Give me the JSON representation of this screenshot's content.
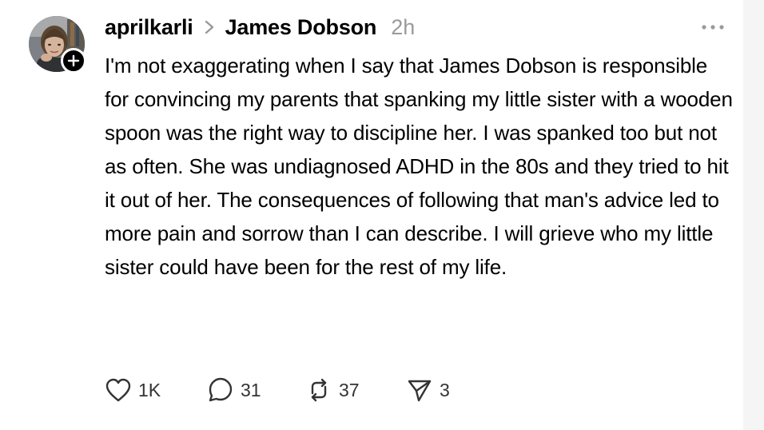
{
  "post": {
    "username": "aprilkarli",
    "reply_to": "James Dobson",
    "timestamp": "2h",
    "text": "I'm not exaggerating when I say that James Dobson is responsible for convincing my parents that spanking my little sister with a wooden spoon was the right way to discipline her. I was spanked too but not as often. She was undiagnosed ADHD in the 80s and they tried to hit it out of her. The consequences of following that man's advice led to more pain and sorrow than I can describe. I will grieve who my little sister could have been for the rest of my life."
  },
  "actions": {
    "likes": "1K",
    "comments": "31",
    "reposts": "37",
    "shares": "3"
  },
  "icons": {
    "avatar": "profile-photo",
    "follow": "plus-icon",
    "separator": "chevron-right-icon",
    "more": "more-horizontal-icon",
    "like": "heart-icon",
    "comment": "speech-bubble-icon",
    "repost": "repost-icon",
    "share": "paper-plane-icon"
  },
  "colors": {
    "text": "#000000",
    "muted": "#9a9a9a",
    "icon": "#333333",
    "background": "#ffffff"
  }
}
